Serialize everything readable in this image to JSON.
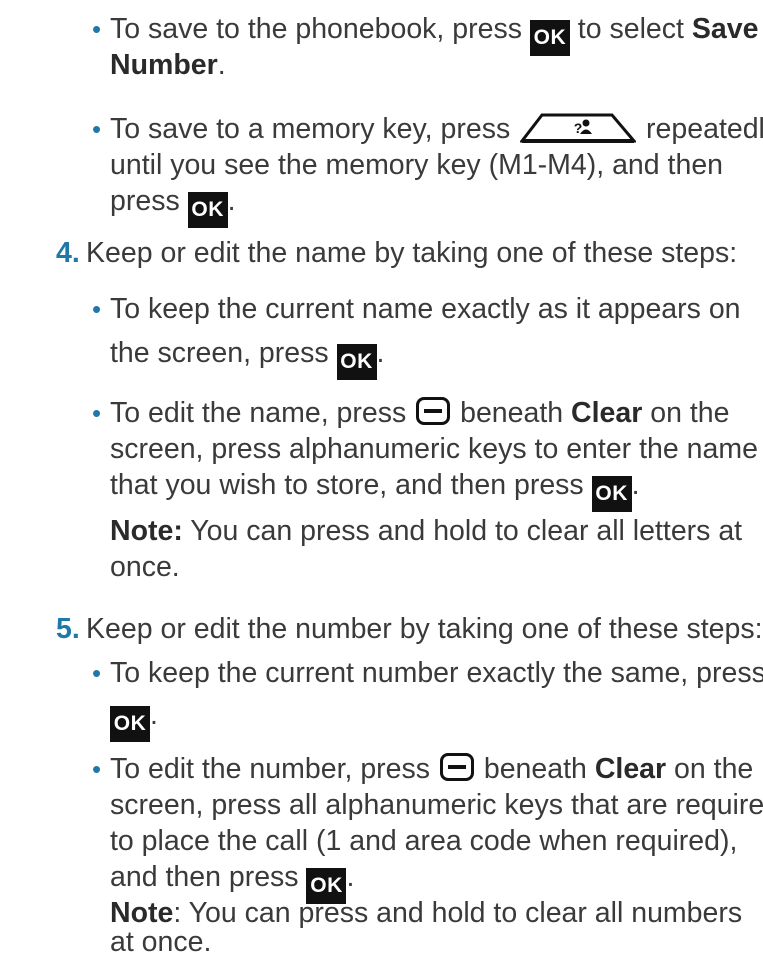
{
  "icons": {
    "ok_key": "OK",
    "memory_key": "?👤",
    "soft_key": "soft-key-icon"
  },
  "items": {
    "b1": {
      "l1a": "To save to the phonebook, press",
      "l1b": "to select",
      "l1c": "Save",
      "l2a": "Number",
      "l2b": "."
    },
    "b2": {
      "l1a": "To save to a memory key, press",
      "l1b": "repeatedly",
      "l2": "until you see the memory key (M1-M4), and then",
      "l3a": "press",
      "l3b": "."
    },
    "s4": {
      "num": "4.",
      "text": "Keep or edit the name by taking one of these steps:"
    },
    "b3": {
      "l1": "To keep the current name exactly as it appears on",
      "l2a": "the screen, press",
      "l2b": "."
    },
    "b4": {
      "l1a": "To edit the name, press",
      "l1b": "beneath",
      "l1c": "Clear",
      "l1d": "on the",
      "l2": "screen, press alphanumeric keys to enter the name",
      "l3a": "that you wish to store, and then press",
      "l3b": "."
    },
    "n1": {
      "label": "Note:",
      "l1": "You can press and hold to clear all letters at",
      "l2": "once."
    },
    "s5": {
      "num": "5.",
      "text": "Keep or edit the number by taking one of these steps:"
    },
    "b5": {
      "l1": "To keep the current number exactly the same, press",
      "l2b": "."
    },
    "b6": {
      "l1a": "To edit the number, press",
      "l1b": "beneath",
      "l1c": "Clear",
      "l1d": "on the",
      "l2": "screen, press all alphanumeric keys that are required",
      "l3": "to place the call (1 and area code when required),",
      "l4a": "and then press",
      "l4b": "."
    },
    "n2": {
      "label": "Note",
      "l1": ": You can press and hold to clear all numbers",
      "l2": "at once."
    }
  }
}
